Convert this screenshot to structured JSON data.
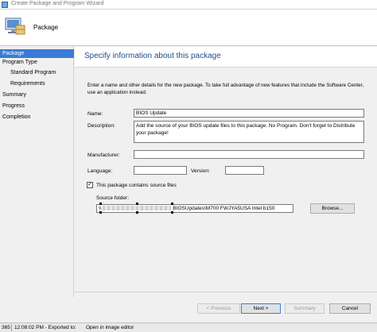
{
  "window": {
    "title": "Create Package and Program Wizard"
  },
  "header": {
    "title": "Package",
    "icon": "computer-package-icon"
  },
  "nav": {
    "items": [
      {
        "label": "Package",
        "active": true,
        "sub": false
      },
      {
        "label": "Program Type",
        "active": false,
        "sub": false
      },
      {
        "label": "Standard Program",
        "active": false,
        "sub": true
      },
      {
        "label": "Requirements",
        "active": false,
        "sub": true
      },
      {
        "label": "Summary",
        "active": false,
        "sub": false
      },
      {
        "label": "Progress",
        "active": false,
        "sub": false
      },
      {
        "label": "Completion",
        "active": false,
        "sub": false
      }
    ]
  },
  "page": {
    "heading": "Specify information about this package",
    "intro": "Enter a name and other details for the new package. To take full advantage of new features that include the Software Center, use an application instead."
  },
  "form": {
    "name_label": "Name:",
    "name_value": "BIOS Update",
    "description_label": "Description:",
    "description_value": "Add the source of your BIOS update files to this package. No Program. Don't forget to Distribute your package!",
    "manufacturer_label": "Manufacturer:",
    "manufacturer_value": "",
    "language_label": "Language:",
    "language_value": "",
    "version_label": "Version:",
    "version_value": "",
    "contains_source_label": "This package contains source files",
    "contains_source_checked": "✓",
    "source_folder_label": "Source folder:",
    "source_folder_prefix": "\\\\",
    "source_folder_suffix": "BIOSUpdates\\M700 FWJYA5USA Intel b150",
    "browse_label": "Browse..."
  },
  "buttons": {
    "previous": "< Previous",
    "next": "Next >",
    "summary": "Summary",
    "cancel": "Cancel"
  },
  "statusbar": {
    "left": "365",
    "time": "12:08:02 PM - Exported to:",
    "action": "Open in image editor"
  },
  "colors": {
    "accent": "#3a7bd5",
    "heading": "#1e4e8c"
  }
}
